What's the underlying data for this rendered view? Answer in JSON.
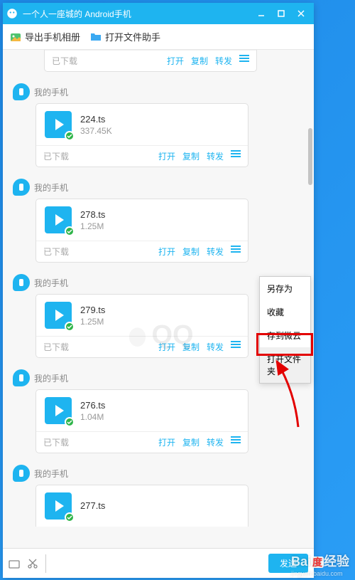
{
  "titlebar": {
    "title": "一个人一座城的 Android手机"
  },
  "toolbar": {
    "export_photos": "导出手机相册",
    "open_file_helper": "打开文件助手"
  },
  "watermark_text": "QQ",
  "partial_top": {
    "status": "已下载",
    "actions": {
      "open": "打开",
      "copy": "复制",
      "forward": "转发"
    }
  },
  "messages": [
    {
      "sender": "我的手机",
      "file": "224.ts",
      "size": "337.45K",
      "status": "已下载",
      "actions": {
        "open": "打开",
        "copy": "复制",
        "forward": "转发"
      }
    },
    {
      "sender": "我的手机",
      "file": "278.ts",
      "size": "1.25M",
      "status": "已下载",
      "actions": {
        "open": "打开",
        "copy": "复制",
        "forward": "转发"
      }
    },
    {
      "sender": "我的手机",
      "file": "279.ts",
      "size": "1.25M",
      "status": "已下载",
      "actions": {
        "open": "打开",
        "copy": "复制",
        "forward": "转发"
      }
    },
    {
      "sender": "我的手机",
      "file": "276.ts",
      "size": "1.04M",
      "status": "已下载",
      "actions": {
        "open": "打开",
        "copy": "复制",
        "forward": "转发"
      }
    },
    {
      "sender": "我的手机",
      "file": "277.ts",
      "size": "",
      "status": "",
      "actions": {
        "open": "",
        "copy": "",
        "forward": ""
      }
    }
  ],
  "context_menu": {
    "save_as": "另存为",
    "favorite": "收藏",
    "save_cloud": "存到微云",
    "open_folder": "打开文件夹"
  },
  "inputbar": {
    "send": "发送"
  },
  "baidu": {
    "brand": "Bai",
    "brand2": "经验",
    "url": "jingyan.baidu.com"
  }
}
